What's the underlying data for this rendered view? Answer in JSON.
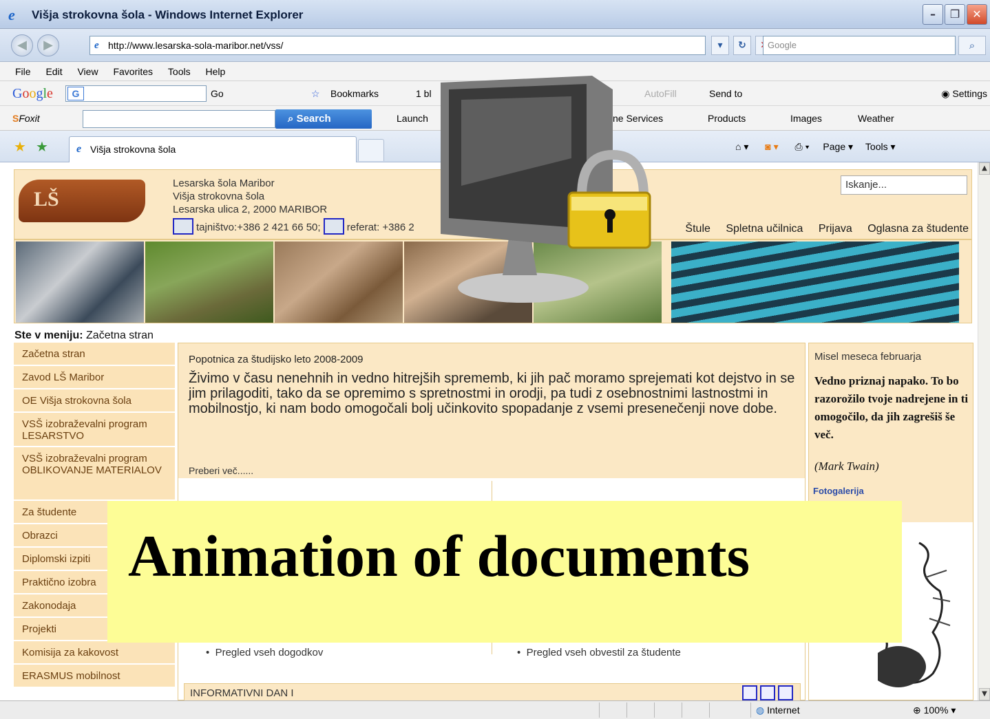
{
  "window": {
    "title": "Višja strokovna šola - Windows Internet Explorer",
    "min": "–",
    "max": "❐",
    "close": "✕"
  },
  "address": {
    "url": "http://www.lesarska-sola-maribor.net/vss/",
    "search_placeholder": "Google"
  },
  "menu": [
    "File",
    "Edit",
    "View",
    "Favorites",
    "Tools",
    "Help"
  ],
  "google_toolbar": {
    "go": "Go",
    "bookmarks": "Bookmarks",
    "blocked": "1 bl",
    "autofill": "AutoFill",
    "send_to": "Send to",
    "settings": "Settings"
  },
  "foxit_toolbar": {
    "brand": "Foxit",
    "search": "Search",
    "launch": "Launch",
    "online_services": "nline Services",
    "products": "Products",
    "images": "Images",
    "weather": "Weather"
  },
  "tabs": {
    "active": "Višja strokovna šola",
    "page": "Page",
    "tools": "Tools"
  },
  "header": {
    "line1": "Lesarska šola Maribor",
    "line2": "Višja strokovna šola",
    "line3": "Lesarska ulica 2, 2000 MARIBOR",
    "contact1": "tajništvo:+386 2 421 66 50;",
    "contact2": "referat: +386 2",
    "logo": "LŠ",
    "search_placeholder": "Iskanje...",
    "links": [
      "Štule",
      "Spletna učilnica",
      "Prijava",
      "Oglasna za študente"
    ]
  },
  "breadcrumb": {
    "label": "Ste v meniju:",
    "value": "Začetna stran"
  },
  "sidebar": [
    "Začetna stran",
    "Zavod LŠ Maribor",
    "OE Višja strokovna šola",
    "VSŠ izobraževalni program LESARSTVO",
    "VSŠ izobraževalni program OBLIKOVANJE MATERIALOV",
    "Za študente",
    "Obrazci",
    "Diplomski izpiti",
    "Praktično izobra",
    "Zakonodaja",
    "Projekti",
    "Komisija za kakovost",
    "ERASMUS mobilnost"
  ],
  "main": {
    "heading": "Popotnica za študijsko leto 2008-2009",
    "text": "Živimo v času nenehnih in vedno hitrejših sprememb, ki jih pač moramo sprejemati kot dejstvo in se jim prilagoditi, tako da se opremimo s spretnostmi in orodji, pa tudi z osebnostnimi lastnostmi in mobilnostjo, ki nam bodo omogočali bolj učinkovito spopadanje z vsemi presenečenji nove dobe.",
    "readmore": "Preberi več......",
    "bullet_left": "Pregled vseh dogodkov",
    "bullet_right": "Pregled vseh obvestil za študente",
    "info": "INFORMATIVNI DAN I"
  },
  "right": {
    "title": "Misel meseca februarja",
    "quote": "Vedno priznaj napako. To bo razorožilo tvoje nadrejene in ti omogočilo, da jih zagrešiš še več.",
    "author": "(Mark Twain)",
    "gallery": "Fotogalerija"
  },
  "status": {
    "zone": "Internet",
    "zoom": "100%"
  },
  "banner": {
    "text": "Animation of documents"
  }
}
